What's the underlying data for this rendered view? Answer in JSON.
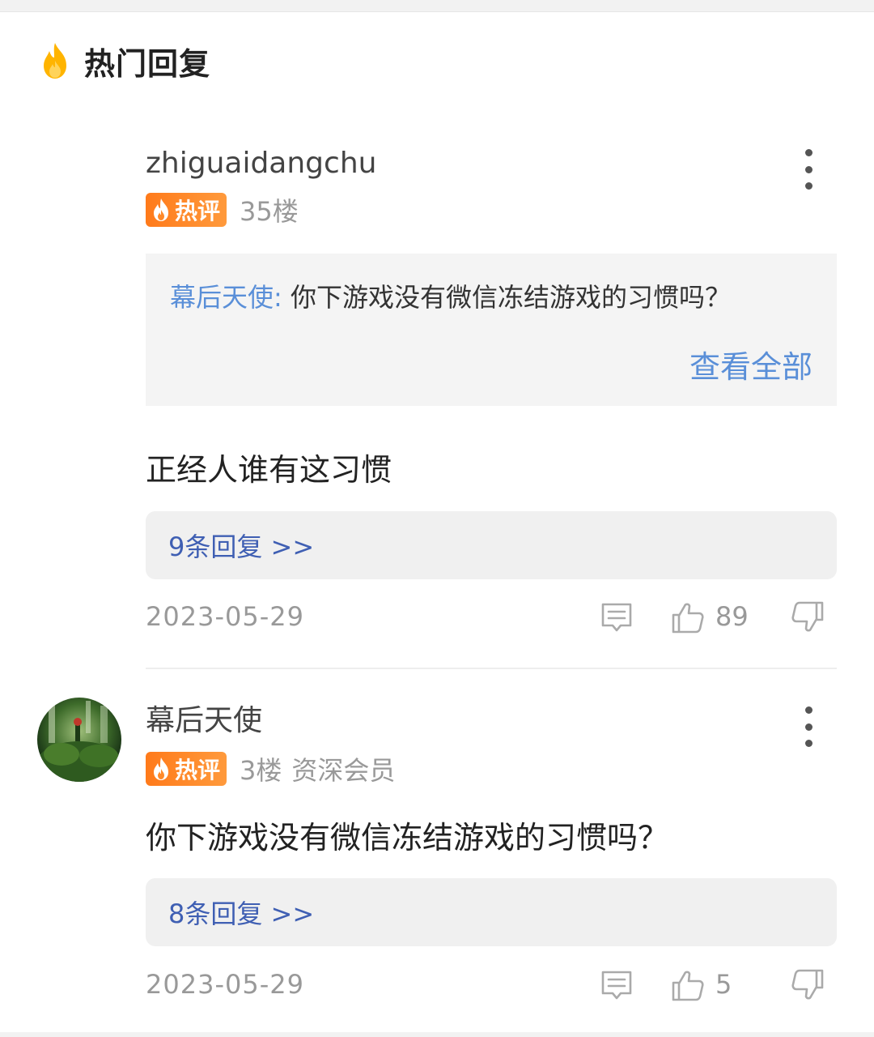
{
  "section": {
    "title": "热门回复",
    "icon": "fire-icon"
  },
  "comments": [
    {
      "username": "zhiguaidangchu",
      "badge": "热评",
      "floor": "35楼",
      "member": "",
      "quote": {
        "author": "幕后天使:",
        "text": "你下游戏没有微信冻结游戏的习惯吗？",
        "view_all": "查看全部"
      },
      "body": "正经人谁有这习惯",
      "replies": "9条回复 >>",
      "date": "2023-05-29",
      "likes": "89"
    },
    {
      "username": "幕后天使",
      "badge": "热评",
      "floor": "3楼",
      "member": "资深会员",
      "body": "你下游戏没有微信冻结游戏的习惯吗？",
      "replies": "8条回复 >>",
      "date": "2023-05-29",
      "likes": "5"
    }
  ],
  "colors": {
    "accent_blue": "#5a8fd8",
    "reply_link": "#3f5fb3",
    "badge_orange": "#ff7a1a",
    "fire_yellow": "#ffb400"
  }
}
